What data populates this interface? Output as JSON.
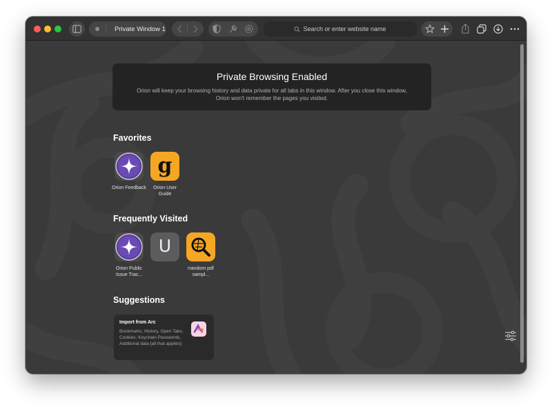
{
  "toolbar": {
    "tab_title": "Private Window 1",
    "address_placeholder": "Search or enter website name"
  },
  "banner": {
    "title": "Private Browsing Enabled",
    "text": "Orion will keep your browsing history and data private for all tabs in this window. After you close this window, Orion won't remember the pages you visited."
  },
  "favorites": {
    "title": "Favorites",
    "items": [
      {
        "label": "Orion Feedback",
        "icon": "orion-star-icon"
      },
      {
        "label": "Orion User Guide",
        "icon": "g-letter-icon"
      }
    ]
  },
  "frequently_visited": {
    "title": "Frequently Visited",
    "items": [
      {
        "label": "Orion Public Issue Trac...",
        "icon": "orion-star-icon"
      },
      {
        "label": "",
        "icon": "u-letter-icon",
        "letter": "U"
      },
      {
        "label": "rrandom pdf sampl...",
        "icon": "search-magnifier-icon"
      }
    ]
  },
  "suggestions": {
    "title": "Suggestions",
    "items": [
      {
        "title": "Import from Arc",
        "text": "Bookmarks, History, Open Tabs, Cookies, Keychain Passwords, Additional data [all that applies]",
        "icon": "arc-logo-icon"
      }
    ]
  },
  "colors": {
    "background": "#3a3a3b",
    "toolbar": "#323233",
    "accent_yellow": "#f5a623",
    "orion_purple": "#5b3fa0"
  }
}
